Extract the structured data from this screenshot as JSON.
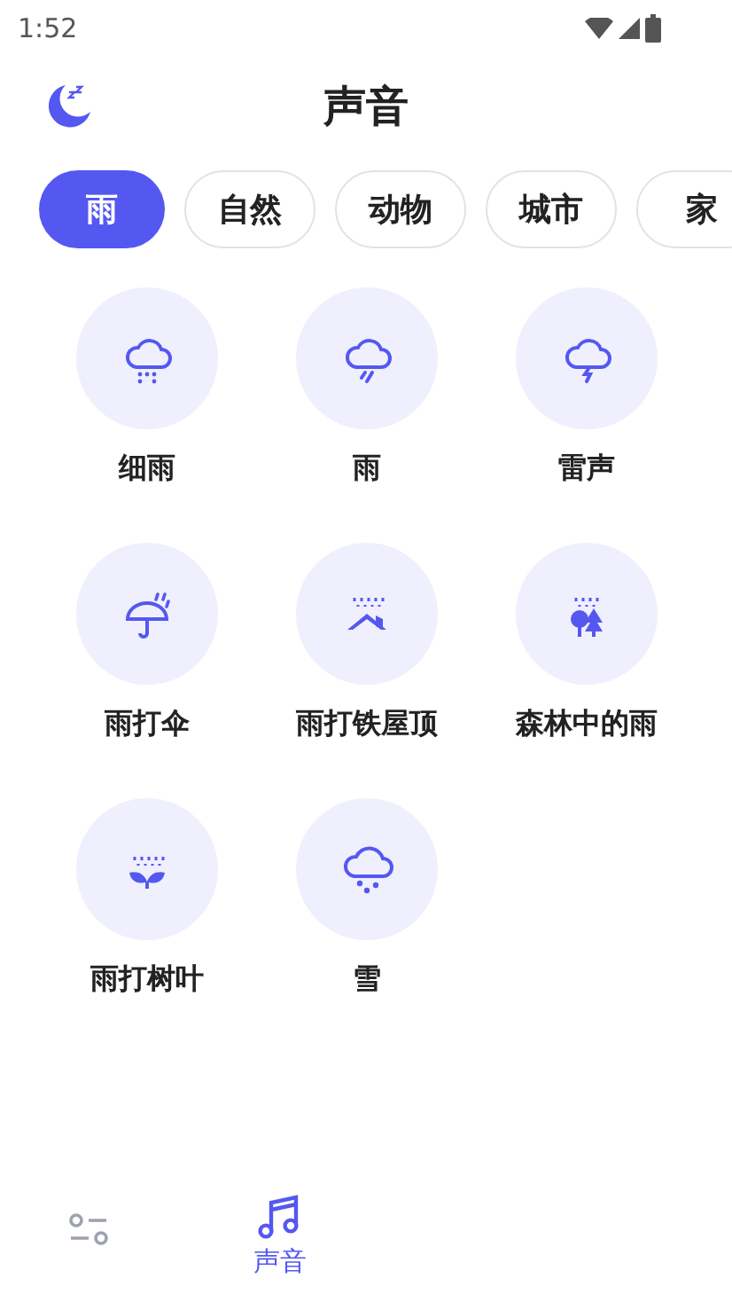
{
  "status_bar": {
    "time": "1:52"
  },
  "header": {
    "title": "声音"
  },
  "tabs": [
    {
      "label": "雨",
      "selected": true
    },
    {
      "label": "自然",
      "selected": false
    },
    {
      "label": "动物",
      "selected": false
    },
    {
      "label": "城市",
      "selected": false
    },
    {
      "label": "家",
      "selected": false
    }
  ],
  "sounds": [
    {
      "label": "细雨"
    },
    {
      "label": "雨"
    },
    {
      "label": "雷声"
    },
    {
      "label": "雨打伞"
    },
    {
      "label": "雨打铁屋顶"
    },
    {
      "label": "森林中的雨"
    },
    {
      "label": "雨打树叶"
    },
    {
      "label": "雪"
    }
  ],
  "bottom_nav": [
    {
      "kind": "mixer",
      "selected": false
    },
    {
      "kind": "music",
      "label": "声音",
      "selected": true
    }
  ]
}
